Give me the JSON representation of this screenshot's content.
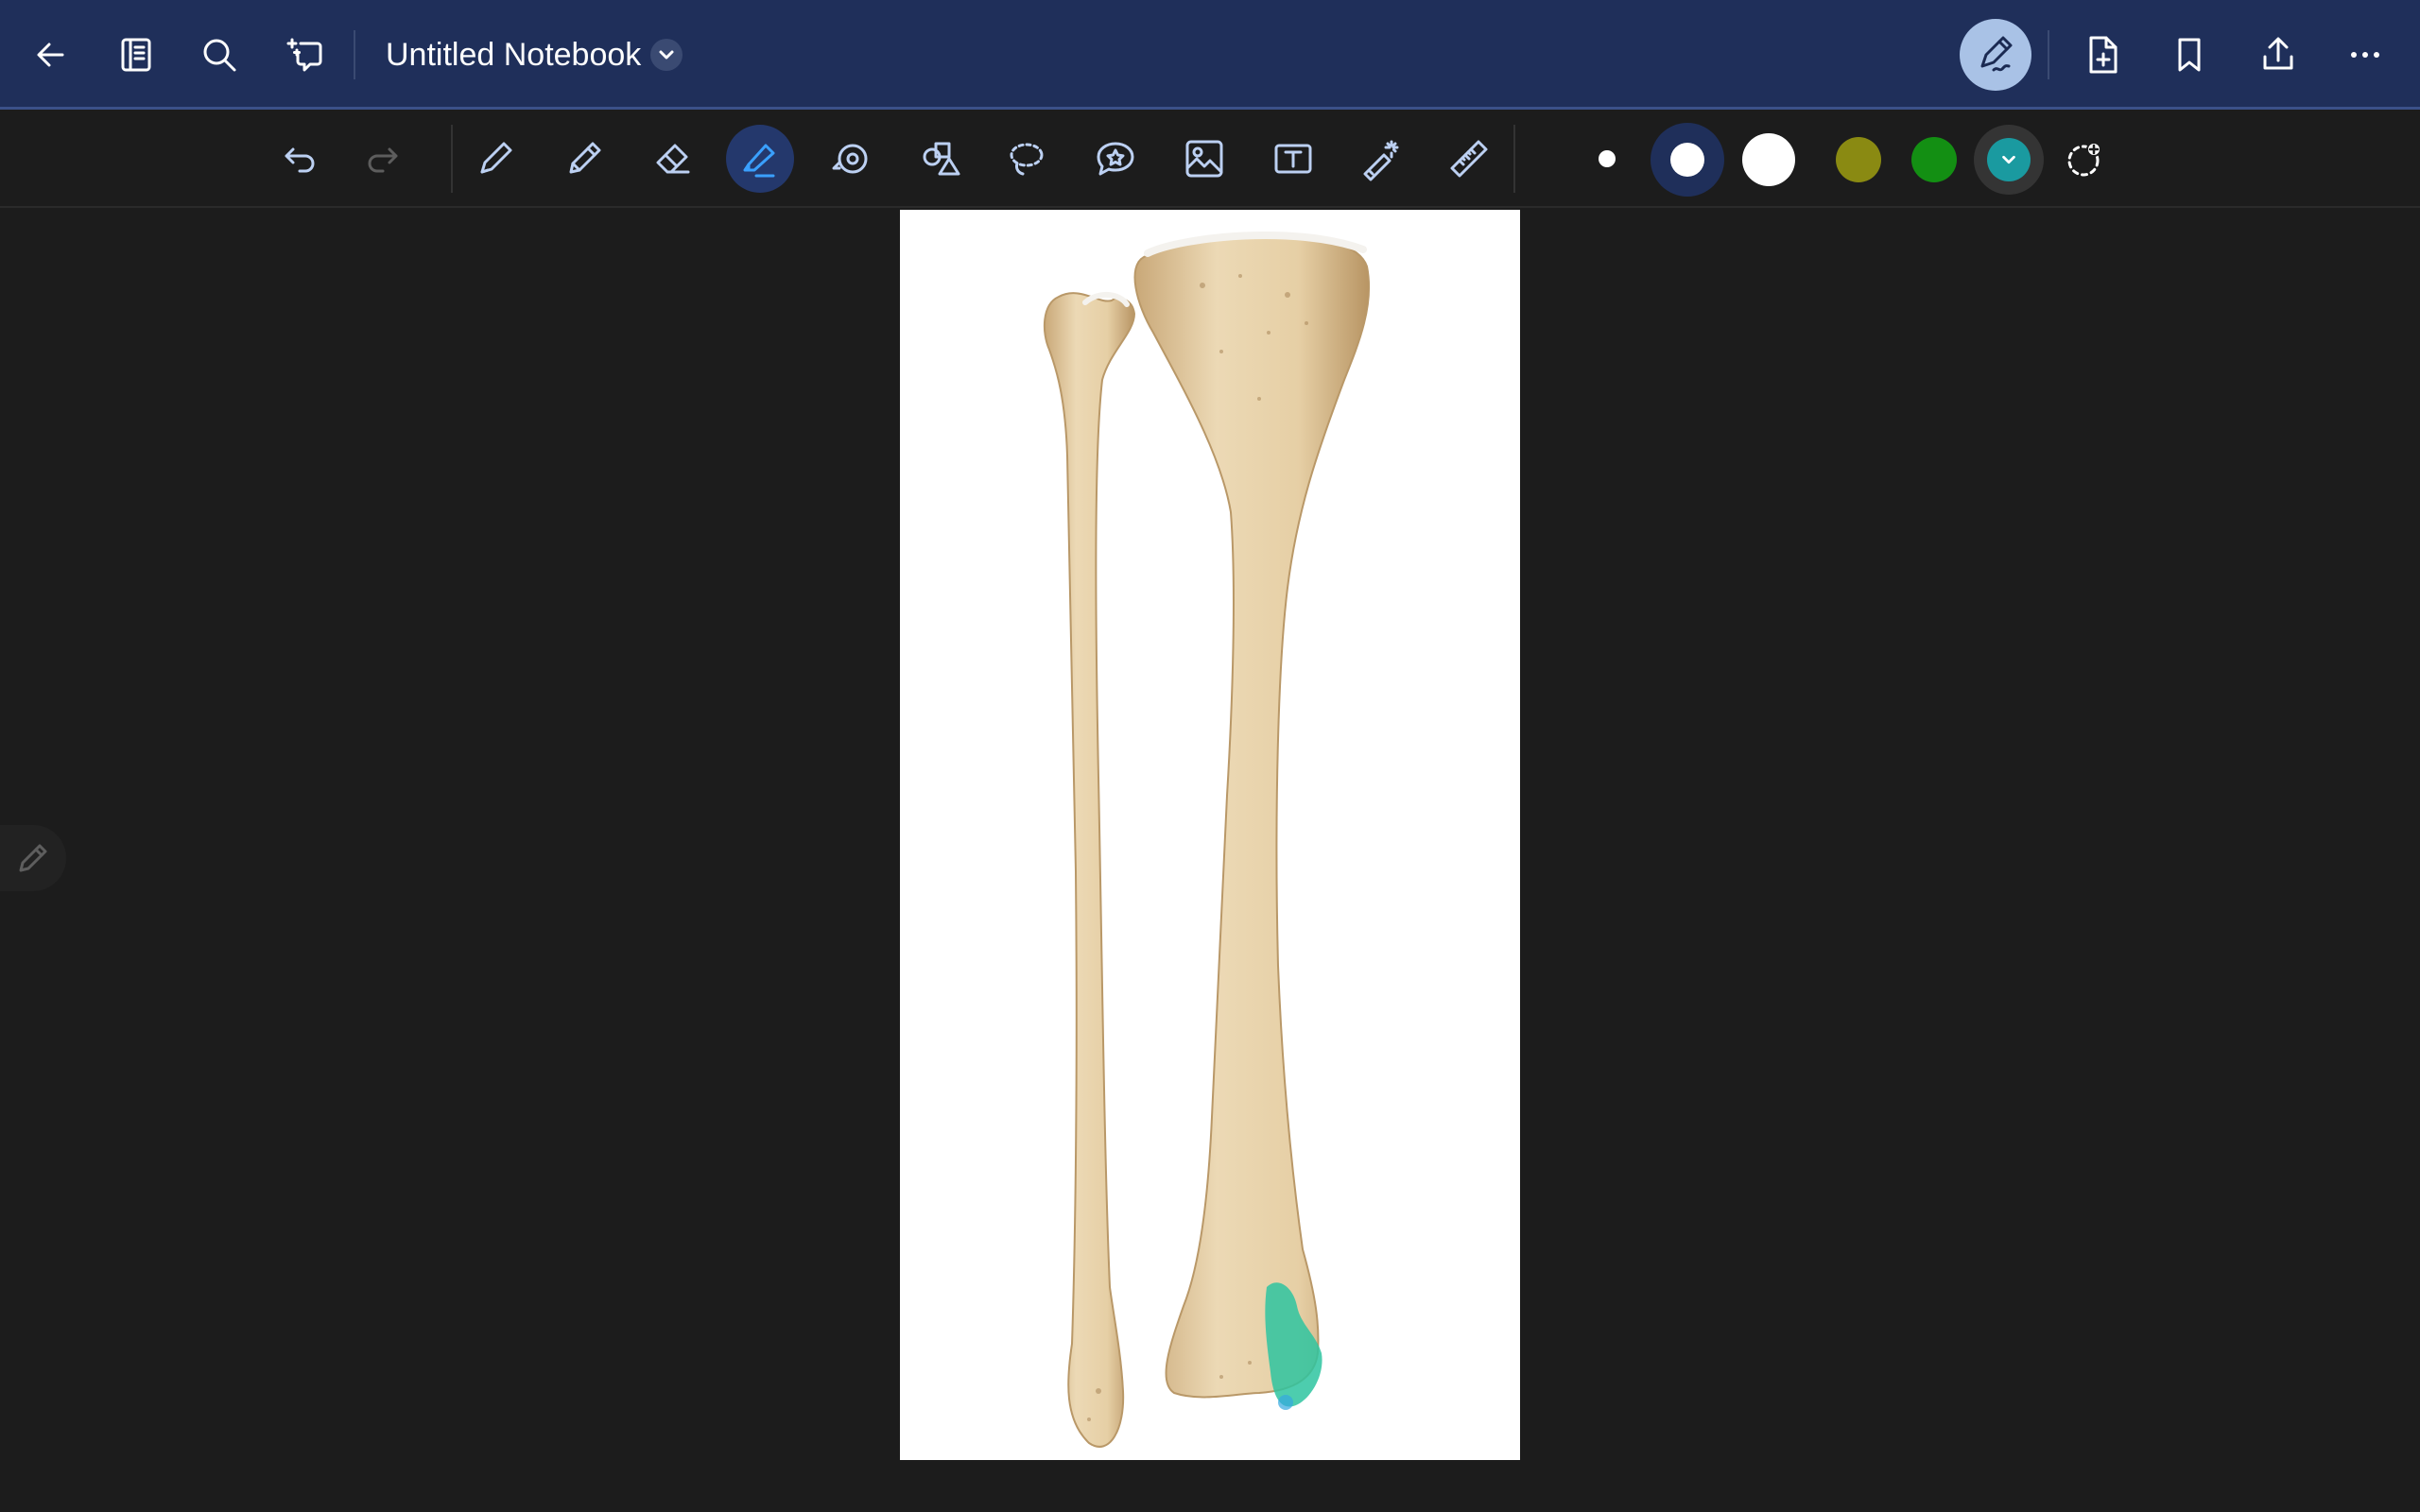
{
  "header": {
    "title": "Untitled Notebook",
    "left_icons": [
      "back-arrow-icon",
      "sidebar-icon",
      "search-icon",
      "ai-chat-icon"
    ],
    "right_icons": [
      "pen-mode-icon",
      "add-page-icon",
      "bookmark-icon",
      "share-icon",
      "more-icon"
    ]
  },
  "toolbar": {
    "tools": [
      "undo-icon",
      "redo-icon",
      "pen-icon",
      "pencil-icon",
      "eraser-icon",
      "highlighter-icon",
      "tape-icon",
      "shapes-icon",
      "lasso-icon",
      "sticker-icon",
      "image-icon",
      "text-icon",
      "laser-pointer-icon",
      "ruler-icon"
    ],
    "active_tool": "highlighter",
    "stroke_sizes": [
      "small",
      "medium",
      "large"
    ],
    "selected_size": "medium",
    "colors": [
      "#8a8a12",
      "#138f13",
      "#1a9aa0"
    ],
    "selected_color": "#1a9aa0",
    "add_color": "add-color-icon"
  },
  "canvas": {
    "content": "bone-illustration",
    "highlight_color": "#2ec4a0"
  },
  "colors": {
    "header_bg": "#1f2f5a",
    "workspace_bg": "#1c1c1c",
    "accent": "#3aa0ff"
  }
}
